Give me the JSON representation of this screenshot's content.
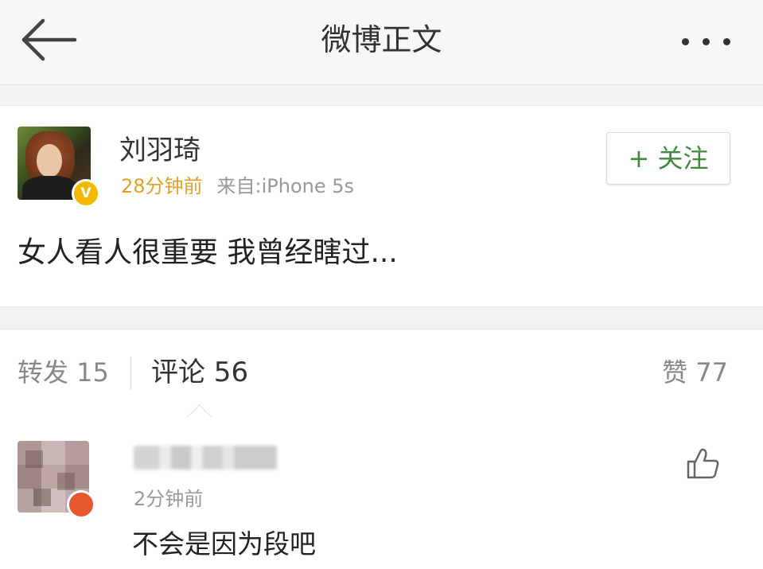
{
  "header": {
    "title": "微博正文",
    "back_icon": "arrow-left-icon",
    "more_icon": "more-dots-icon"
  },
  "post": {
    "author_name": "刘羽琦",
    "verified_icon": "verified-v-icon",
    "verified_label": "V",
    "time": "28分钟前",
    "source": "来自:iPhone 5s",
    "follow_label": "+ 关注",
    "text": "女人看人很重要 我曾经瞎过..."
  },
  "stats": {
    "repost": "转发 15",
    "comment": "评论 56",
    "like": "赞 77"
  },
  "comments": [
    {
      "time": "2分钟前",
      "text": "不会是因为段吧",
      "like_icon": "thumbs-up-icon"
    }
  ],
  "colors": {
    "follow_green": "#3d8b3d",
    "time_orange": "#e5a127",
    "verified_yellow": "#f5b800"
  }
}
